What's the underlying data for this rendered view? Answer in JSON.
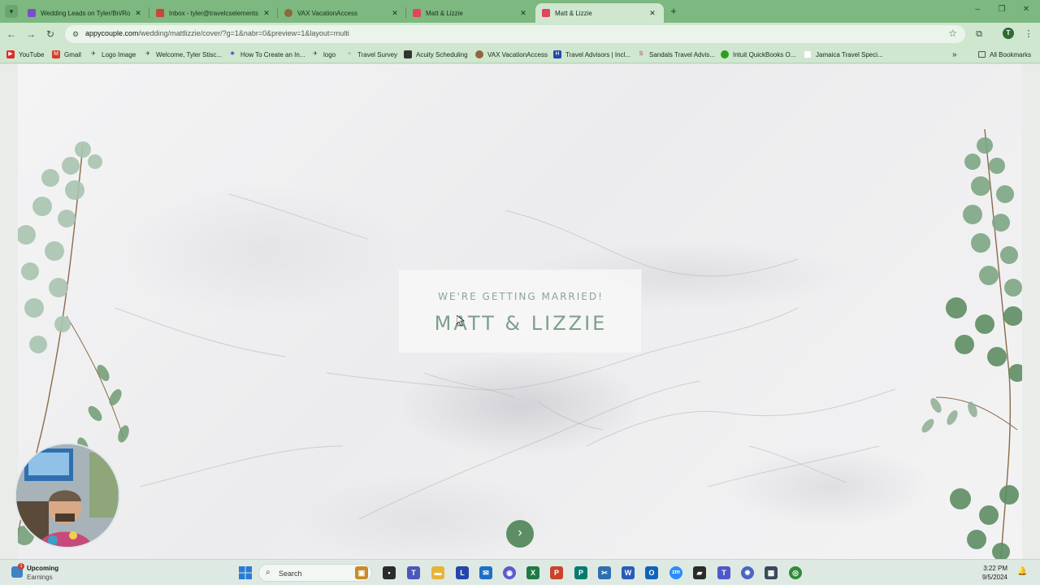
{
  "browser": {
    "tabs": [
      {
        "title": "Wedding Leads on Tyler/Bri/Ro",
        "favicon_color": "#7b4dc9",
        "active": false
      },
      {
        "title": "Inbox - tyler@travelcselements",
        "favicon_color": "#c9473a",
        "active": false
      },
      {
        "title": "VAX VacationAccess",
        "favicon_color": "#8a6a3a",
        "active": false
      },
      {
        "title": "Matt & Lizzie",
        "favicon_color": "#e0455c",
        "active": false
      },
      {
        "title": "Matt & Lizzie",
        "favicon_color": "#e0455c",
        "active": true
      }
    ],
    "url_host": "appycouple.com",
    "url_path": "/wedding/mattlizzie/cover/?g=1&nabr=0&preview=1&layout=multi",
    "profile_initial": "T",
    "bookmarks": [
      {
        "label": "YouTube",
        "icon_color": "#e02a2a",
        "icon": "▶"
      },
      {
        "label": "Gmail",
        "icon_color": "#d93a2e",
        "icon": "M"
      },
      {
        "label": "Logo Image",
        "icon_color": "#333333",
        "icon": "✈"
      },
      {
        "label": "Welcome, Tyler Stisc...",
        "icon_color": "#333333",
        "icon": "✈"
      },
      {
        "label": "How To Create an In...",
        "icon_color": "#4a5bd6",
        "icon": "✹"
      },
      {
        "label": "logo",
        "icon_color": "#333333",
        "icon": "✈"
      },
      {
        "label": "Travel Survey",
        "icon_color": "#7c8a9a",
        "icon": "+"
      },
      {
        "label": "Acuity Scheduling",
        "icon_color": "#333333",
        "icon": "■"
      },
      {
        "label": "VAX VacationAccess",
        "icon_color": "#8a6a3a",
        "icon": "V"
      },
      {
        "label": "Travel Advisors | Incl...",
        "icon_color": "#1f4aa5",
        "icon": "H"
      },
      {
        "label": "Sandals Travel Advis...",
        "icon_color": "#c2302a",
        "icon": "S"
      },
      {
        "label": "Intuit QuickBooks O...",
        "icon_color": "#2ca01c",
        "icon": "qb"
      },
      {
        "label": "Jamaica Travel Speci...",
        "icon_color": "#ffffff",
        "icon": ""
      }
    ],
    "all_bookmarks": "All Bookmarks"
  },
  "page": {
    "subtitle": "WE'RE GETTING MARRIED!",
    "names": "MATT & LIZZIE",
    "next_icon": "chevron-right-icon"
  },
  "taskbar": {
    "weather_title": "Upcoming",
    "weather_sub": "Earnings",
    "weather_badge": "1",
    "search_label": "Search",
    "time": "3:22 PM",
    "date": "9/5/2024",
    "apps": [
      {
        "name": "widgets",
        "color": "#c98b2a",
        "glyph": "▣"
      },
      {
        "name": "terminal",
        "color": "#2b2b2b",
        "glyph": "▪"
      },
      {
        "name": "teams-badge",
        "color": "#4b58b8",
        "glyph": "T"
      },
      {
        "name": "file-explorer",
        "color": "#e7b43b",
        "glyph": "▬"
      },
      {
        "name": "l-app",
        "color": "#2446a8",
        "glyph": "L"
      },
      {
        "name": "mail",
        "color": "#1f6fc4",
        "glyph": "✉"
      },
      {
        "name": "copilot",
        "color": "#5a5ad0",
        "glyph": "◉"
      },
      {
        "name": "excel",
        "color": "#1f7a44",
        "glyph": "X"
      },
      {
        "name": "powerpoint",
        "color": "#c8442a",
        "glyph": "P"
      },
      {
        "name": "publisher",
        "color": "#067b6e",
        "glyph": "P"
      },
      {
        "name": "snipping",
        "color": "#2f6fb0",
        "glyph": "✂"
      },
      {
        "name": "word",
        "color": "#2a5bb8",
        "glyph": "W"
      },
      {
        "name": "outlook",
        "color": "#0f64b8",
        "glyph": "O"
      },
      {
        "name": "zoom",
        "color": "#2d8cff",
        "glyph": "zm"
      },
      {
        "name": "sticky-notes",
        "color": "#2b2b2b",
        "glyph": "▰"
      },
      {
        "name": "teams",
        "color": "#5059c9",
        "glyph": "T"
      },
      {
        "name": "settings",
        "color": "#4a64c7",
        "glyph": "✹"
      },
      {
        "name": "calculator",
        "color": "#3a4a5a",
        "glyph": "▦"
      },
      {
        "name": "chrome",
        "color": "#2e8b3a",
        "glyph": "◎"
      }
    ]
  }
}
